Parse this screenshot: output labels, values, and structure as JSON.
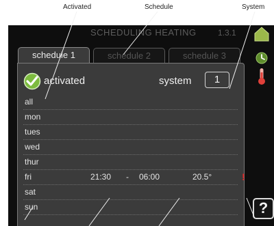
{
  "callouts": {
    "activated": "Activated",
    "schedule": "Schedule",
    "system": "System"
  },
  "header": {
    "title": "SCHEDULING HEATING",
    "menu_number": "1.3.1"
  },
  "tabs": [
    {
      "label": "schedule 1",
      "active": true
    },
    {
      "label": "schedule 2",
      "active": false
    },
    {
      "label": "schedule 3",
      "active": false
    }
  ],
  "activated": {
    "label": "activated",
    "checked": true
  },
  "system": {
    "label": "system",
    "value": "1"
  },
  "days": [
    "all",
    "mon",
    "tues",
    "wed",
    "thur",
    "fri",
    "sat",
    "sun"
  ],
  "fri_schedule": {
    "start": "21:30",
    "separator": "-",
    "end": "06:00",
    "temperature": "20.5°"
  },
  "conflict_marker": "!",
  "help": {
    "label": "?"
  },
  "icons": [
    "house-icon",
    "clock-icon",
    "thermometer-icon",
    "warning-icon",
    "help-icon"
  ],
  "colors": {
    "screen_bg": "#0e0e0e",
    "panel_bg": "#3b3b3b",
    "check_green": "#7dbb3f",
    "house_green": "#9bb84a",
    "clock_green": "#5f8d2c",
    "thermo_red": "#e0403a",
    "warning_red": "#e02424"
  }
}
